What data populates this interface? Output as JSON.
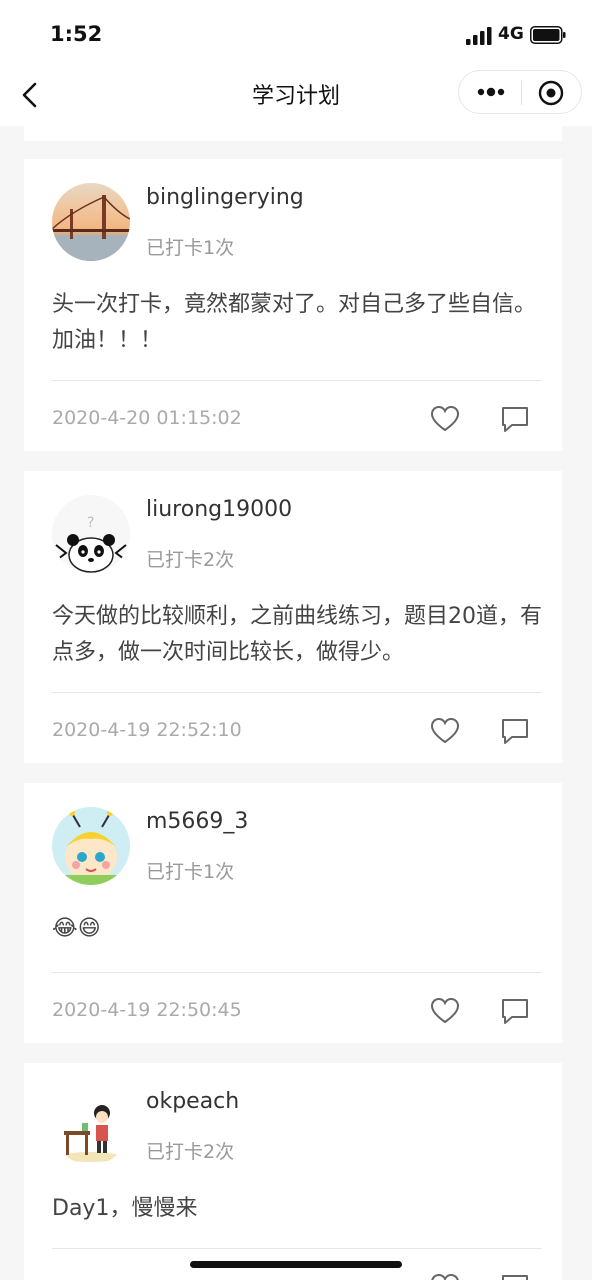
{
  "status_bar": {
    "time": "1:52",
    "network": "4G"
  },
  "navbar": {
    "title": "学习计划"
  },
  "icons": [
    "back-chevron-icon",
    "more-dots-icon",
    "target-circle-icon",
    "heart-icon",
    "comment-icon",
    "signal-icon",
    "battery-icon"
  ],
  "colors": {
    "background": "#f6f6f6",
    "card": "#ffffff",
    "meta_text": "#999999"
  },
  "posts": [
    {
      "username": "binglingerying",
      "checkin": "已打卡1次",
      "content": "头一次打卡，竟然都蒙对了。对自己多了些自信。加油！！！",
      "date": "2020-4-20 01:15:02"
    },
    {
      "username": "liurong19000",
      "checkin": "已打卡2次",
      "content": "今天做的比较顺利，之前曲线练习，题目20道，有点多，做一次时间比较长，做得少。",
      "date": "2020-4-19 22:52:10"
    },
    {
      "username": "m5669_3",
      "checkin": "已打卡1次",
      "content": "😂😄",
      "date": "2020-4-19 22:50:45"
    },
    {
      "username": "okpeach",
      "checkin": "已打卡2次",
      "content": "Day1，慢慢来",
      "date": ""
    }
  ]
}
